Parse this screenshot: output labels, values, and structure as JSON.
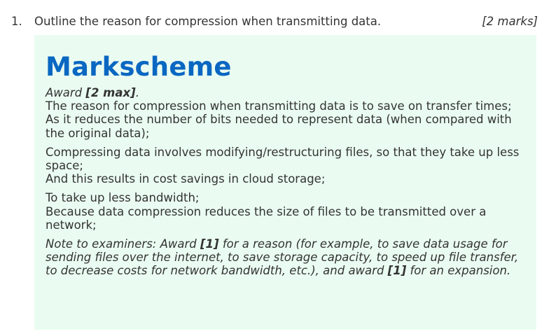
{
  "question": {
    "number": "1.",
    "text": "Outline the reason for compression when transmitting data.",
    "marks": "[2 marks]"
  },
  "markscheme": {
    "title": "Markscheme",
    "award_prefix": "Award ",
    "award_marks": "[2 max]",
    "award_suffix": ".",
    "point_groups": [
      [
        "The reason for compression when transmitting data is to save on transfer times;",
        "As it reduces the number of bits needed to represent data (when compared with the original data);"
      ],
      [
        "Compressing data involves modifying/restructuring files, so that they take up less space;",
        "And this results in cost savings in cloud storage;"
      ],
      [
        "To take up less bandwidth;",
        "Because data compression reduces the size of files to be transmitted over a network;"
      ]
    ],
    "note": {
      "part1": "Note to examiners: Award ",
      "mark1": "[1]",
      "part2": " for a reason (for example, to save data usage for sending files over the internet, to save storage capacity, to speed up file transfer, to decrease costs for network bandwidth, etc.), and award ",
      "mark2": "[1]",
      "part3": " for an expansion."
    }
  }
}
